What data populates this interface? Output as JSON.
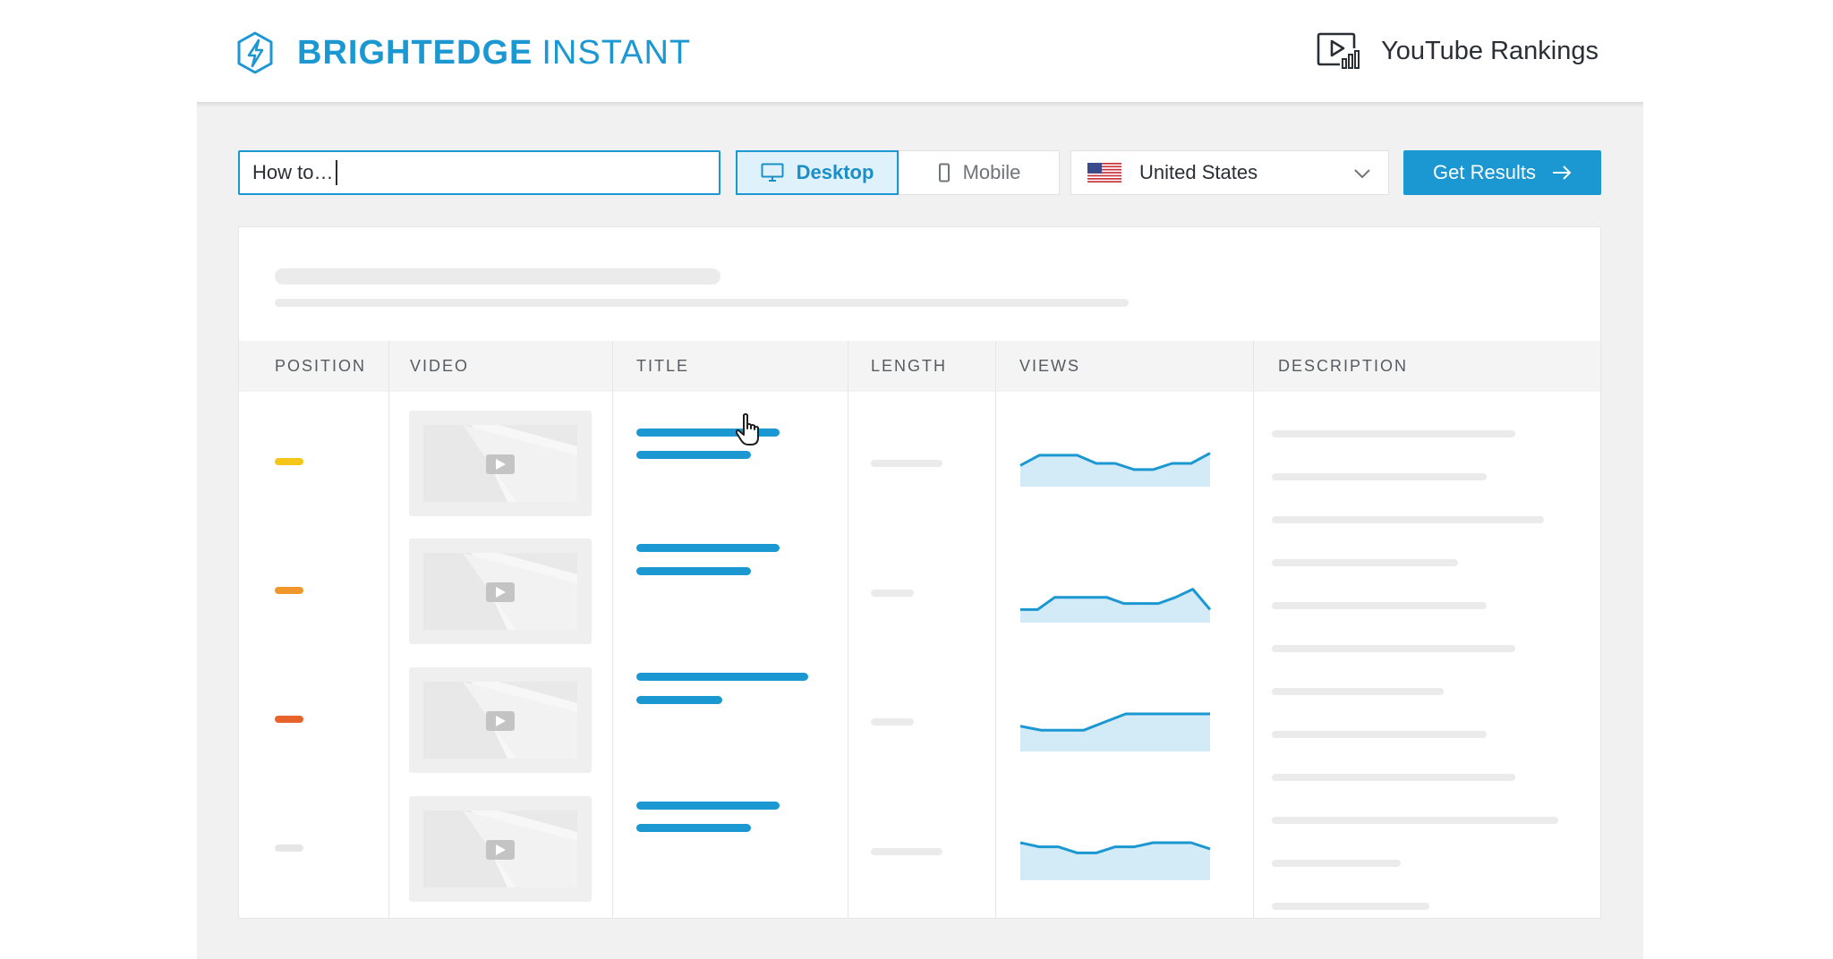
{
  "header": {
    "brand_bold": "BRIGHTEDGE",
    "brand_light": "INSTANT",
    "logo_icon": "lightning-hexagon-icon",
    "tool_icon": "video-chart-icon",
    "tool_label": "YouTube Rankings"
  },
  "controls": {
    "search_value": "How to…",
    "device_desktop": "Desktop",
    "device_mobile": "Mobile",
    "selected_device": "Desktop",
    "country": "United States",
    "country_flag_icon": "us-flag-icon",
    "submit_label": "Get Results"
  },
  "table": {
    "columns": [
      "POSITION",
      "VIDEO",
      "TITLE",
      "LENGTH",
      "VIEWS",
      "DESCRIPTION"
    ],
    "position_colors": [
      "#f5c518",
      "#f0962a",
      "#e8622c",
      "#e6e6e6"
    ],
    "views_trends": [
      [
        8,
        3,
        3,
        3,
        7,
        7,
        10,
        10,
        7,
        7,
        2
      ],
      [
        12,
        12,
        6,
        6,
        6,
        6,
        9,
        9,
        9,
        6,
        2,
        12
      ],
      [
        6,
        8,
        8,
        8,
        4,
        0,
        0,
        0,
        0,
        0
      ],
      [
        0,
        2,
        2,
        5,
        5,
        2,
        2,
        0,
        0,
        0,
        3
      ]
    ]
  },
  "colors": {
    "accent": "#1b97d2",
    "accent_light": "#dff1fa",
    "panel_bg": "#f1f1f1",
    "skeleton": "#ebebeb"
  }
}
